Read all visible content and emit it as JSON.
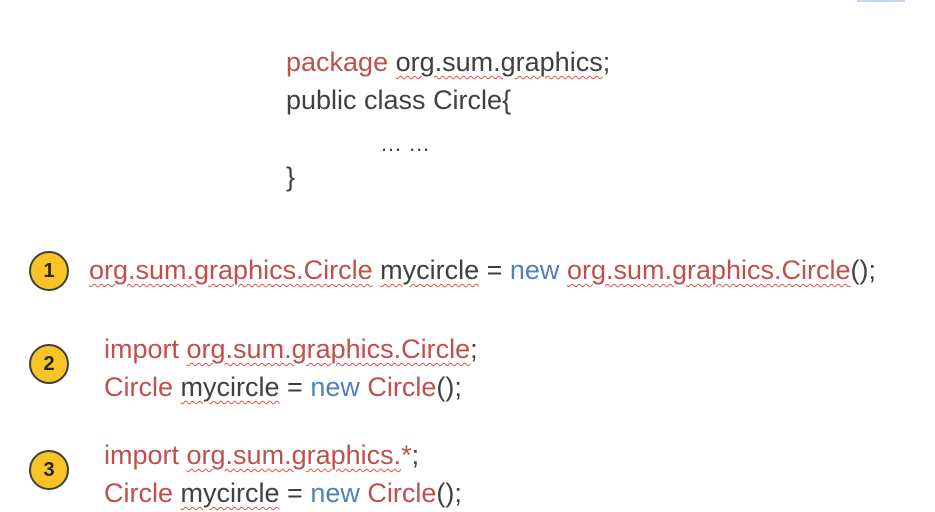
{
  "package_block": {
    "line1_kw": "package",
    "line1_pkg": "org.sum.graphics",
    "line1_semi": ";",
    "line2": "public class Circle{",
    "line3": "… …",
    "line4": "}"
  },
  "examples": [
    {
      "badge": "1",
      "line1": {
        "a": "org.sum.graphics.Circle",
        "b": " ",
        "c": "mycircle",
        "d": " = ",
        "e": "new",
        "f": " ",
        "g": "org.sum.graphics.Circle",
        "h": "();"
      }
    },
    {
      "badge": "2",
      "line1": {
        "kw": "import",
        "sp": " ",
        "pkg": "org.sum.graphics.Circle",
        "end": ";"
      },
      "line2": {
        "cls": "Circle",
        "sp": " ",
        "var": "mycircle",
        "eq": " = ",
        "new": "new",
        "sp2": " ",
        "ctor": "Circle",
        "end": "();"
      }
    },
    {
      "badge": "3",
      "line1": {
        "kw": "import",
        "sp": " ",
        "pkg": "org.sum.graphics.",
        "star": "*",
        "end": ";"
      },
      "line2": {
        "cls": "Circle",
        "sp": " ",
        "var": "mycircle",
        "eq": " = ",
        "new": "new",
        "sp2": " ",
        "ctor": "Circle",
        "end": "();"
      }
    }
  ],
  "colors": {
    "keyword_red": "#c0504d",
    "keyword_blue": "#4f81bd",
    "text": "#404040",
    "badge_fill": "#f7c325"
  }
}
